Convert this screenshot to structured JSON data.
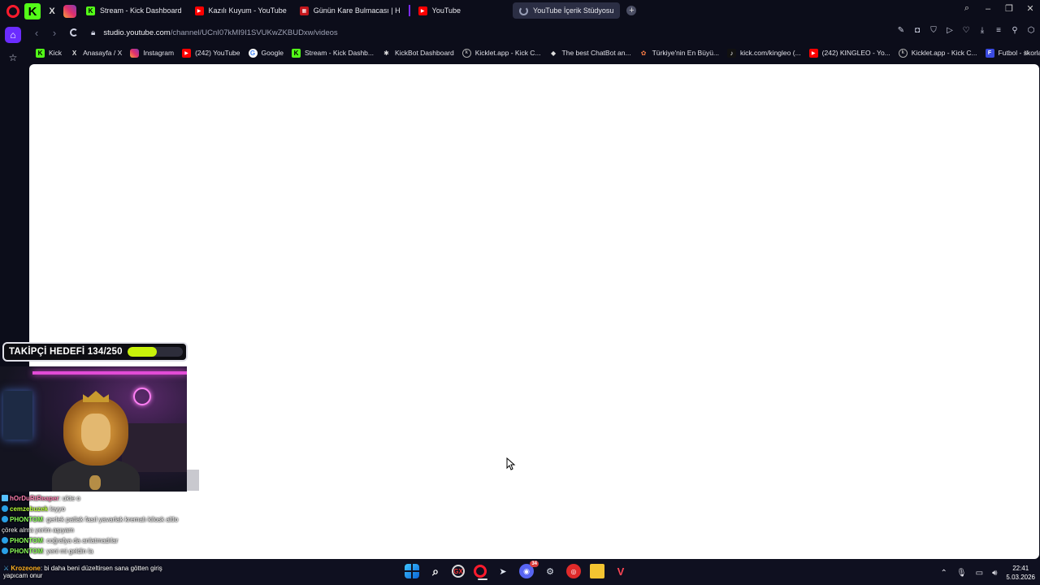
{
  "browser": {
    "pinned_tabs": [
      {
        "icon": "kick-logo-icon",
        "glyph": "K"
      },
      {
        "icon": "x-logo-icon",
        "glyph": "X"
      },
      {
        "icon": "instagram-icon",
        "glyph": ""
      }
    ],
    "tabs": [
      {
        "label": "Stream - Kick Dashboard",
        "icon": "kick-icon",
        "glyph": "K",
        "active": false
      },
      {
        "label": "Kazılı Kuyum - YouTube",
        "icon": "youtube-icon",
        "glyph": "▶",
        "active": false
      },
      {
        "label": "Günün Kare Bulmacası | H",
        "icon": "puzzle-site-icon",
        "glyph": "▦",
        "active": false
      },
      {
        "label": "YouTube",
        "icon": "youtube-icon",
        "glyph": "▶",
        "active": false
      },
      {
        "label": "YouTube İçerik Stüdyosu",
        "icon": "loading-icon",
        "glyph": "",
        "active": true
      }
    ],
    "new_tab_glyph": "+",
    "address": {
      "url_domain": "studio.youtube.com",
      "url_path": "/channel/UCnI07kMI9I1SVUKwZKBUDxw/videos"
    },
    "bookmarks": [
      {
        "label": "Kick",
        "icon": "kick-icon",
        "glyph": "K",
        "cls": "kick"
      },
      {
        "label": "Anasayfa / X",
        "icon": "x-logo-icon",
        "glyph": "X",
        "cls": "x"
      },
      {
        "label": "Instagram",
        "icon": "instagram-icon",
        "glyph": "",
        "cls": "ig"
      },
      {
        "label": "(242) YouTube",
        "icon": "youtube-icon",
        "glyph": "▶",
        "cls": "yt"
      },
      {
        "label": "Google",
        "icon": "google-icon",
        "glyph": "G",
        "cls": "g"
      },
      {
        "label": "Stream - Kick Dashb...",
        "icon": "kick-icon",
        "glyph": "K",
        "cls": "kick"
      },
      {
        "label": "KickBot Dashboard",
        "icon": "kickbot-icon",
        "glyph": "✱",
        "cls": "x"
      },
      {
        "label": "Kicklet.app - Kick C...",
        "icon": "kicklet-icon",
        "glyph": "k",
        "cls": "kl"
      },
      {
        "label": "The best ChatBot an...",
        "icon": "chatbot-icon",
        "glyph": "◆",
        "cls": "diamond"
      },
      {
        "label": "Türkiye'nin En Büyü...",
        "icon": "turkiye-site-icon",
        "glyph": "✿",
        "cls": "tr"
      },
      {
        "label": "kick.com/kingleo (...",
        "icon": "tiktok-icon",
        "glyph": "♪",
        "cls": "tt"
      },
      {
        "label": "(242) KINGLEO - Yo...",
        "icon": "youtube-icon",
        "glyph": "▶",
        "cls": "yt"
      },
      {
        "label": "Kicklet.app - Kick C...",
        "icon": "kicklet-icon",
        "glyph": "k",
        "cls": "kl"
      },
      {
        "label": "Futbol - skorlar, tak...",
        "icon": "futbol-site-icon",
        "glyph": "F",
        "cls": "fb"
      }
    ]
  },
  "overlay": {
    "follower_goal": {
      "label": "TAKİPÇİ HEDEFİ 134/250",
      "current": 134,
      "target": 250,
      "bar_color": "#c8f20a"
    },
    "chat": [
      {
        "badge": "sword",
        "user": "hOrDuRtReaper",
        "user_color": "#ff7fb0",
        "text": ": ukte o"
      },
      {
        "badge": "round",
        "user": "cemzebuzek",
        "user_color": "#b8ff3a",
        "text": " leyyo"
      },
      {
        "badge": "round",
        "user": "PHONTOM",
        "user_color": "#8cff5a",
        "text": ": gerlek patlak fasıl yavarlak kremalı kilosk altlo"
      },
      {
        "badge": "none",
        "user": "",
        "user_color": "#ffffff",
        "text": "çörek alma yerim aşıyam"
      },
      {
        "badge": "round",
        "user": "PHONTOM",
        "user_color": "#8cff5a",
        "text": ": coğrafya da anlatmadılar"
      },
      {
        "badge": "round",
        "user": "PHONTOM",
        "user_color": "#8cff5a",
        "text": ": yeni mi geldin la"
      }
    ],
    "taskbar_chat": {
      "user": "Krozeone",
      "text": ": bi daha beni düzeltirsen sana götten giriş",
      "text2": "yapıcam onur"
    }
  },
  "taskbar": {
    "apps": [
      {
        "name": "start-button",
        "icon": "windows-icon",
        "cls": "win",
        "glyph": ""
      },
      {
        "name": "search-button",
        "icon": "search-icon",
        "cls": "search",
        "glyph": "⌕"
      },
      {
        "name": "opera-gx-app",
        "icon": "opera-gx-icon",
        "cls": "gx",
        "glyph": "GX"
      },
      {
        "name": "opera-app",
        "icon": "opera-icon",
        "cls": "opera",
        "glyph": ""
      },
      {
        "name": "telegram-app",
        "icon": "telegram-icon",
        "cls": "steam",
        "glyph": "➤"
      },
      {
        "name": "discord-app",
        "icon": "discord-icon",
        "cls": "discord",
        "glyph": "◉",
        "badge": "34"
      },
      {
        "name": "steam-app",
        "icon": "steam-icon",
        "cls": "steam",
        "glyph": "⚙"
      },
      {
        "name": "red-app",
        "icon": "red-circle-app-icon",
        "cls": "red",
        "glyph": "◎"
      },
      {
        "name": "file-explorer-app",
        "icon": "folder-icon",
        "cls": "folder",
        "glyph": ""
      },
      {
        "name": "valorant-app",
        "icon": "valorant-icon",
        "cls": "valorant",
        "glyph": "V"
      }
    ],
    "clock": {
      "time": "22:41",
      "date": "5.03.2026"
    }
  }
}
